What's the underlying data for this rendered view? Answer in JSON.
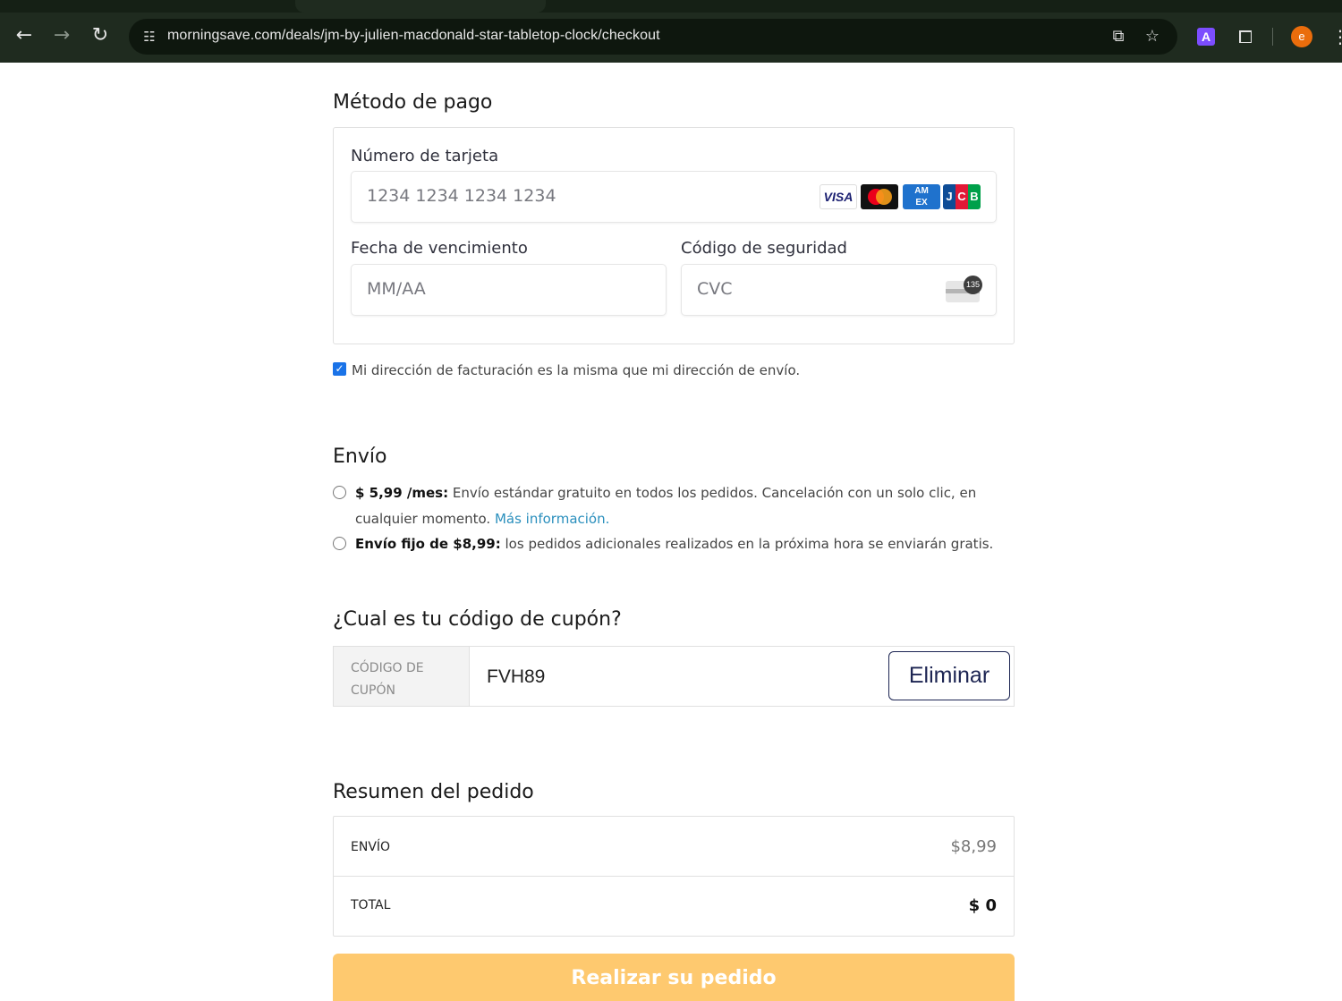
{
  "browser": {
    "url": "morningsave.com/deals/jm-by-julien-macdonald-star-tabletop-clock/checkout",
    "extension_badge": "A",
    "profile_initial": "e"
  },
  "payment": {
    "heading": "Método de pago",
    "card_number_label": "Número de tarjeta",
    "card_number_placeholder": "1234 1234 1234 1234",
    "card_brands": [
      "VISA",
      "mastercard",
      "AMEX",
      "JCB"
    ],
    "expiry_label": "Fecha de vencimiento",
    "expiry_placeholder": "MM/AA",
    "cvc_label": "Código de seguridad",
    "cvc_placeholder": "CVC",
    "cvc_icon_digits": "135",
    "billing_same_checked": true,
    "billing_same_label": "Mi dirección de facturación es la misma que mi dirección de envío."
  },
  "shipping": {
    "heading": "Envío",
    "option1_price": "$ 5,99 /mes:",
    "option1_text_line1": " Envío estándar gratuito en todos los pedidos. Cancelación con un solo clic, en",
    "option1_text_line2": "cualquier momento. ",
    "option1_link": "Más información.",
    "option2_price": "Envío fijo de $8,99:",
    "option2_text": " los pedidos adicionales realizados en la próxima hora se enviarán gratis."
  },
  "coupon": {
    "heading": "¿Cual es tu código de cupón?",
    "label": "CÓDIGO DE CUPÓN",
    "value": "FVH89",
    "remove_button": "Eliminar"
  },
  "summary": {
    "heading": "Resumen del pedido",
    "shipping_label": "ENVÍO",
    "shipping_value": "$8,99",
    "total_label": "TOTAL",
    "total_value": "$ 0"
  },
  "place_order_button": "Realizar su pedido",
  "colors": {
    "chrome_bg": "#1f2b1f",
    "checkbox_accent": "#1a73e8",
    "link": "#2a8fbd",
    "remove_button_border": "#1c2452",
    "place_order_bg": "#fec96f"
  }
}
